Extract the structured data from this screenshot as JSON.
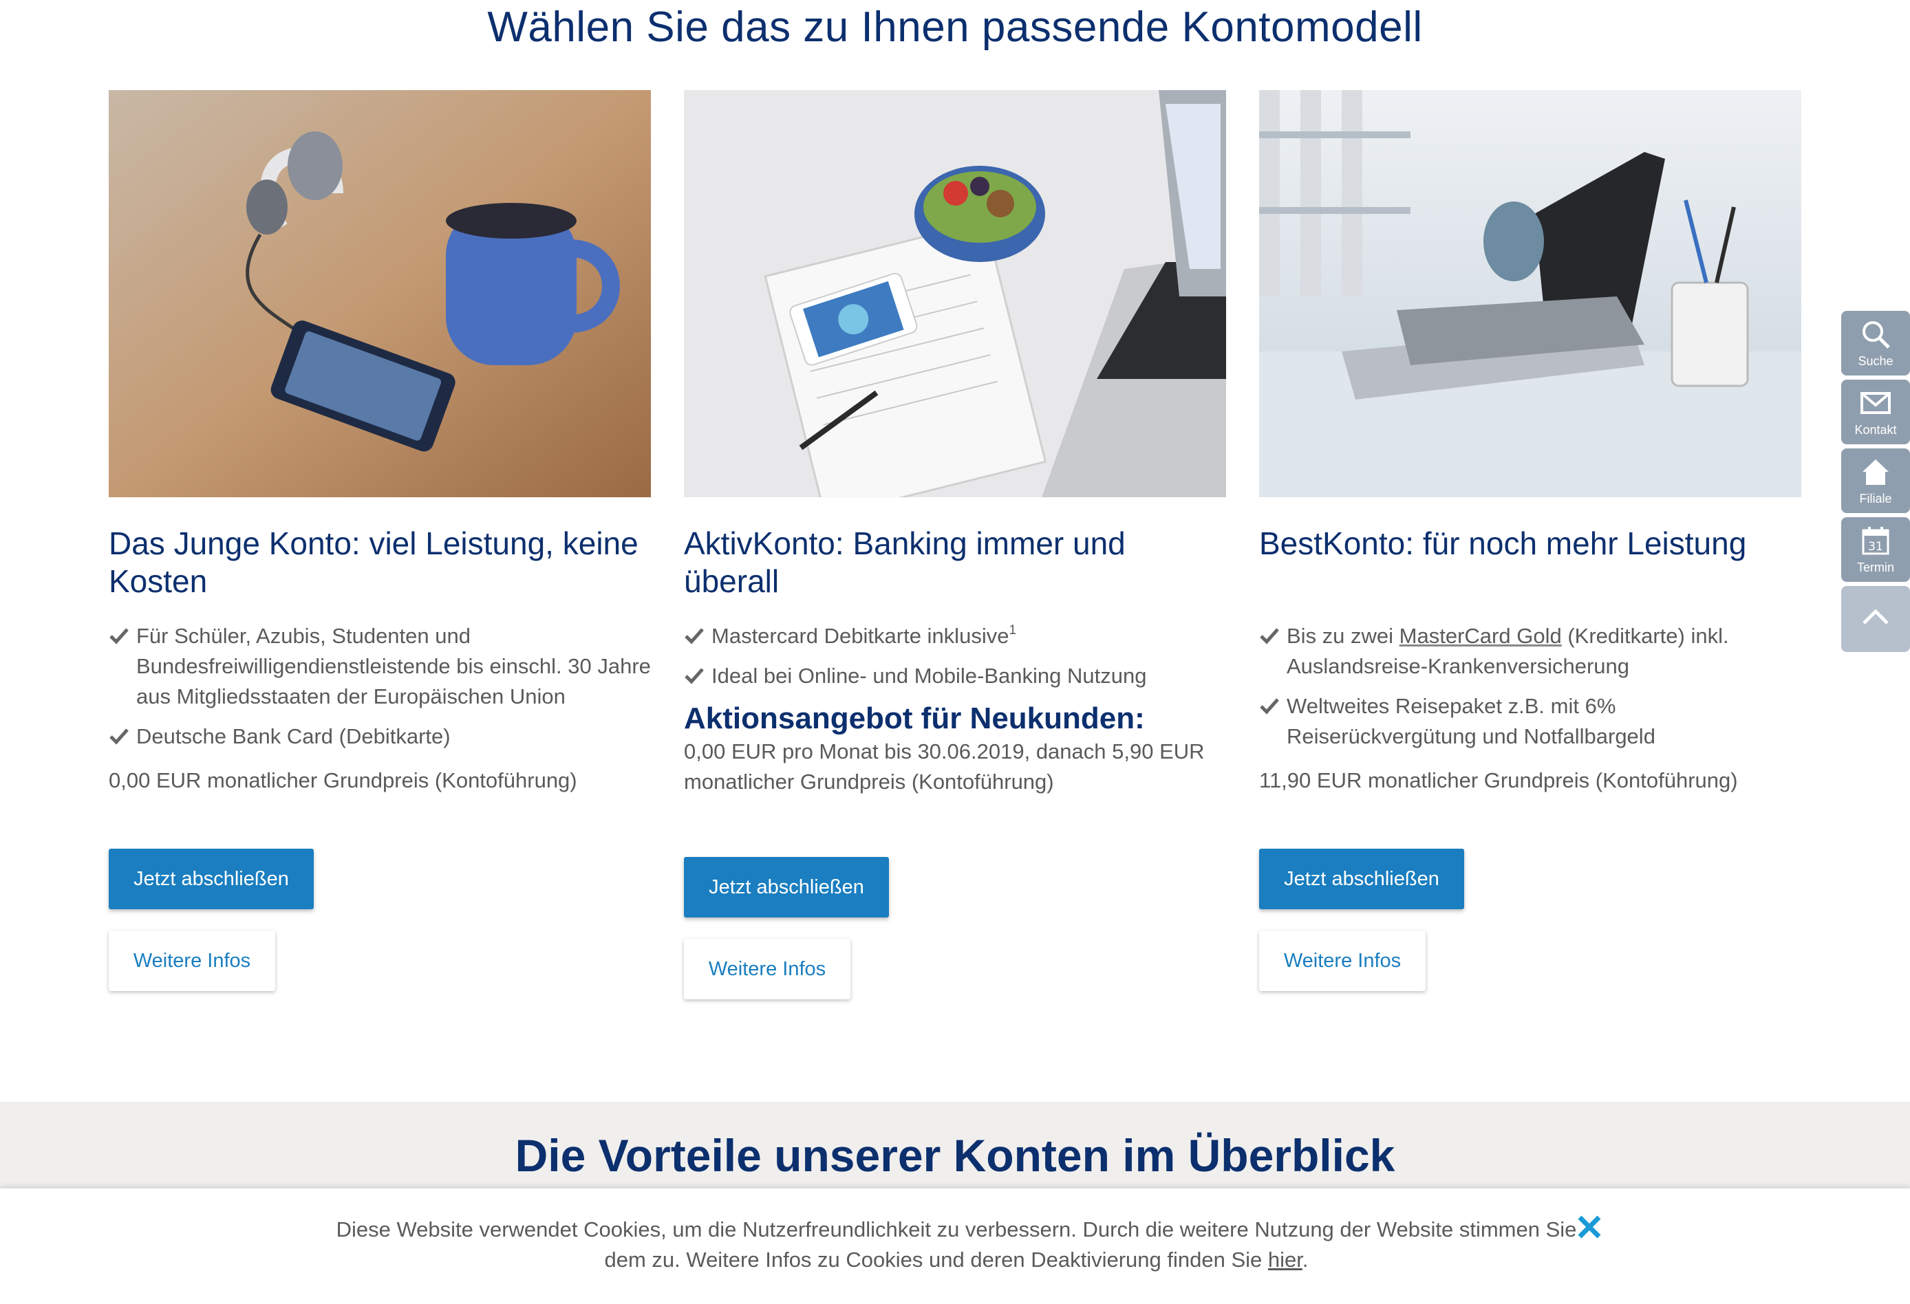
{
  "heading": "Wählen Sie das zu Ihnen passende Kontomodell",
  "cards": [
    {
      "title": "Das Junge Konto: viel Leistung, keine Kosten",
      "bullets": [
        "Für Schüler, Azubis, Studenten und Bundesfreiwilligendienstleistende bis einschl. 30 Jahre aus Mitgliedsstaaten der Europäischen Union",
        "Deutsche Bank Card (Debitkarte)"
      ],
      "price": "0,00 EUR monatlicher Grundpreis (Kontoführung)",
      "primary_button": "Jetzt abschließen",
      "secondary_button": "Weitere Infos"
    },
    {
      "title": "AktivKonto: Banking immer und überall",
      "bullets": [
        "Mastercard Debitkarte inklusive",
        "Ideal bei Online- und Mobile-Banking Nutzung"
      ],
      "footnote": "1",
      "promo_title": "Aktionsangebot für Neukunden:",
      "promo_text": "0,00 EUR pro Monat bis 30.06.2019, danach 5,90 EUR monatlicher Grundpreis (Kontoführung)",
      "primary_button": "Jetzt abschließen",
      "secondary_button": "Weitere Infos"
    },
    {
      "title": "BestKonto: für noch mehr Leistung",
      "bullet1_pre": "Bis zu zwei ",
      "bullet1_link": "MasterCard Gold",
      "bullet1_post": " (Kreditkarte) inkl. Auslandsreise-Krankenversicherung",
      "bullets": [
        "Weltweites Reisepaket z.B. mit 6% Reiserückvergütung und Notfallbargeld"
      ],
      "price": "11,90 EUR monatlicher Grundpreis (Kontoführung)",
      "primary_button": "Jetzt abschließen",
      "secondary_button": "Weitere Infos"
    }
  ],
  "side_nav": {
    "search": "Suche",
    "contact": "Kontakt",
    "branch": "Filiale",
    "appointment": "Termin",
    "calendar_day": "31"
  },
  "benefits_heading": "Die Vorteile unserer Konten im Überblick",
  "cookie": {
    "text": "Diese Website verwendet Cookies, um die Nutzerfreundlichkeit zu verbessern. Durch die weitere Nutzung der Website stimmen Sie dem zu. Weitere Infos zu Cookies und deren Deaktivierung finden Sie ",
    "link": "hier",
    "end": "."
  },
  "colors": {
    "heading": "#0c2f6e",
    "primary": "#1a7ec0",
    "side_nav": "#8f9eae",
    "close_icon": "#1a9ad6"
  }
}
